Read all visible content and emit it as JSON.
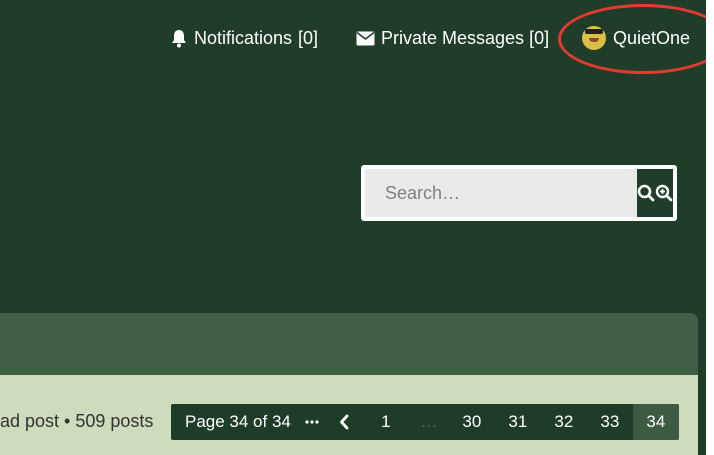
{
  "header": {
    "notifications": {
      "label": "Notifications",
      "count_display": "[0]"
    },
    "private_messages": {
      "label": "Private Messages",
      "count_display": "[0]"
    },
    "user": {
      "name": "QuietOne"
    }
  },
  "search": {
    "placeholder": "Search…"
  },
  "topic_stats": {
    "text": "ad post • 509 posts"
  },
  "pagination": {
    "label": "Page 34 of 34",
    "pages": [
      "1",
      "…",
      "30",
      "31",
      "32",
      "33",
      "34"
    ],
    "current": "34"
  },
  "colors": {
    "background": "#1f3d28",
    "highlight": "#e33b2f",
    "content_band": "#cddcbc",
    "pagination_bg": "#1e3d28",
    "pagination_current": "#3b5b42"
  },
  "icons": [
    "bell-icon",
    "envelope-icon",
    "user-avatar",
    "search-icon",
    "advanced-search-icon",
    "ellipsis-icon",
    "chevron-left-icon"
  ]
}
